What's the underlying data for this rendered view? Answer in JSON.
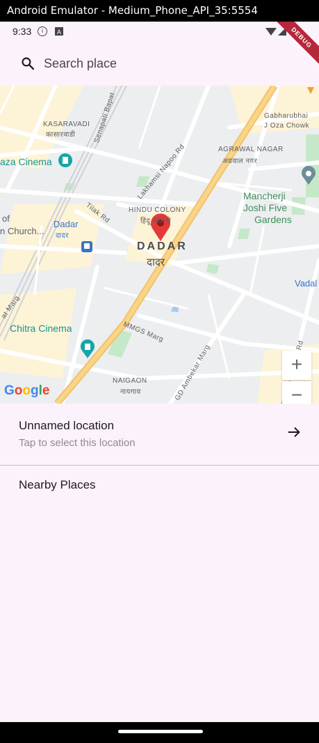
{
  "window_title": "Android Emulator - Medium_Phone_API_35:5554",
  "status_bar": {
    "time": "9:33",
    "debug_label": "DEBUG"
  },
  "search": {
    "placeholder": "Search place"
  },
  "map": {
    "labels": {
      "kasaravadi": "KASARAVADI",
      "kasaravadi_mr": "कासारवाडी",
      "senapati": "Senapati Bapat",
      "gabharubhai": "Gabharubhai",
      "oza_chowk": "J Oza Chowk",
      "plaza_cinema": "aza Cinema",
      "lakhamsi": "Lakhamsi Napoo Rd",
      "agrawal": "AGRAWAL NAGAR",
      "agrawal_mr": "अग्रवाल नगर",
      "mancherji": "Mancherji",
      "joshi": "Joshi Five",
      "gardens": "Gardens",
      "tilak": "Tilak Rd",
      "hindu_colony": "HINDU COLONY",
      "hindu_colony_mr": "हिंदू कॉलनी",
      "of": "of",
      "church": "n Church...",
      "dadar_station": "Dadar",
      "dadar_station_mr": "दादर",
      "dadar": "DADAR",
      "dadar_mr": "दादर",
      "vadala": "Vadal",
      "marg_left": "at Marg",
      "chitra": "Chitra Cinema",
      "mmgs": "MMGS Marg",
      "ambekar": "GD Ambekar Marg",
      "rafi": "Rafi Ahmed Kidwai Rd",
      "naigaon": "NAIGAON",
      "naigaon_mr": "नायगाव"
    },
    "zoom_in": "+",
    "zoom_out": "−",
    "google_logo": [
      "G",
      "o",
      "o",
      "g",
      "l",
      "e"
    ],
    "logo_colors": [
      "#4285F4",
      "#EA4335",
      "#FBBC05",
      "#4285F4",
      "#34A853",
      "#EA4335"
    ],
    "pin_color": "#e53935"
  },
  "selected_location": {
    "title": "Unnamed location",
    "subtitle": "Tap to select this location"
  },
  "nearby": {
    "heading": "Nearby Places"
  }
}
